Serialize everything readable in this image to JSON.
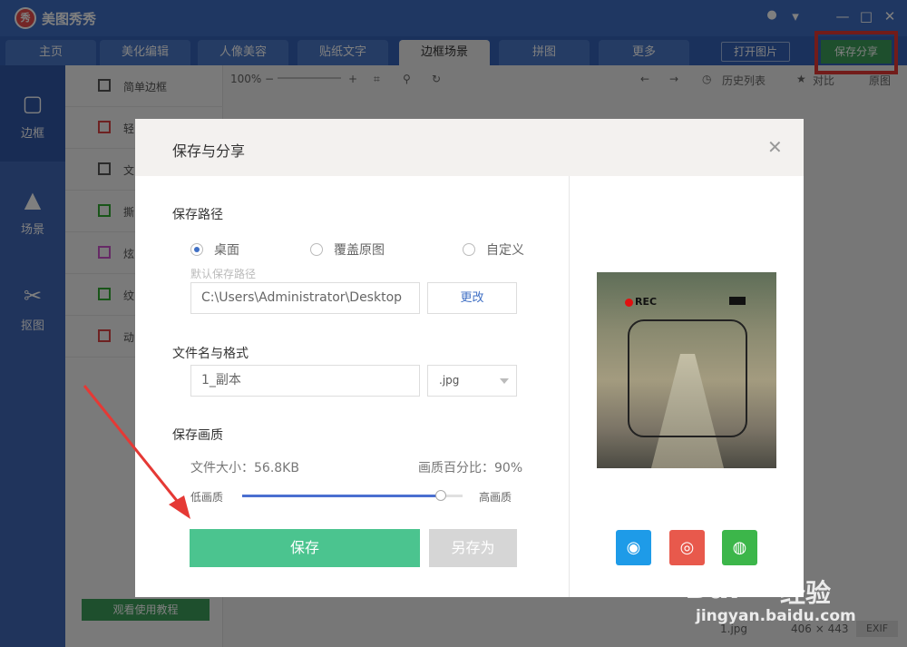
{
  "app": {
    "title": "美图秀秀",
    "logo_text": "秀"
  },
  "tabs": [
    {
      "label": "主页"
    },
    {
      "label": "美化编辑"
    },
    {
      "label": "人像美容"
    },
    {
      "label": "贴纸文字"
    },
    {
      "label": "边框场景"
    },
    {
      "label": "拼图"
    },
    {
      "label": "更多"
    }
  ],
  "header_buttons": {
    "open_image": "打开图片",
    "save_share": "保存分享"
  },
  "left_nav": [
    {
      "label": "边框",
      "icon": "frame-icon"
    },
    {
      "label": "场景",
      "icon": "scene-icon"
    },
    {
      "label": "抠图",
      "icon": "scissors-icon"
    }
  ],
  "sub_list": [
    {
      "label": "简单边框"
    },
    {
      "label": "轻"
    },
    {
      "label": "文"
    },
    {
      "label": "撕"
    },
    {
      "label": "炫"
    },
    {
      "label": "纹"
    },
    {
      "label": "动"
    }
  ],
  "tutorial_button": "观看使用教程",
  "toolbar": {
    "zoom": "100%",
    "history": "历史列表",
    "compare": "对比",
    "more": "原图"
  },
  "bottom": {
    "filename": "1.jpg",
    "dimensions": "406 × 443",
    "exif": "EXIF"
  },
  "dialog": {
    "title": "保存与分享",
    "path_section": "保存路径",
    "options": [
      "桌面",
      "覆盖原图",
      "自定义"
    ],
    "selected_option": 0,
    "path_hint": "默认保存路径",
    "path_value": "C:\\Users\\Administrator\\Desktop",
    "change_button": "更改",
    "filename_section": "文件名与格式",
    "filename_value": "1_副本",
    "format_value": ".jpg",
    "quality_section": "保存画质",
    "file_size": "文件大小：56.8KB",
    "quality_percent": "画质百分比：90%",
    "quality_value": 0.9,
    "low_label": "低画质",
    "high_label": "高画质",
    "save_button": "保存",
    "save_as_button": "另存为",
    "preview_rec": "REC"
  },
  "watermark": {
    "brand": "Bai",
    "brand2": "经验",
    "url": "jingyan.baidu.com"
  },
  "colors": {
    "accent": "#3f6fc4",
    "save_green": "#4bc48f",
    "highlight_red": "#e53935"
  }
}
